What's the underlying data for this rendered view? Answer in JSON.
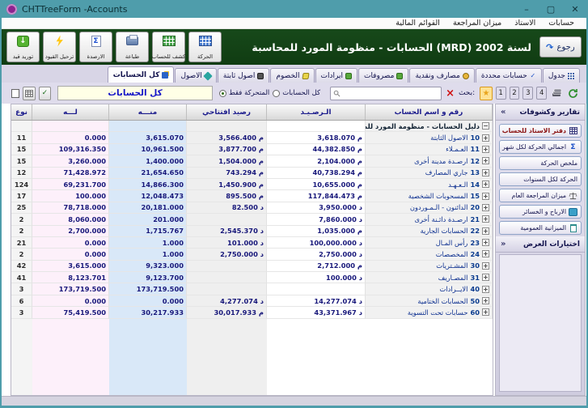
{
  "window": {
    "title": "CHTTreeForm -Accounts",
    "controls": {
      "minimize": "–",
      "maximize": "▢",
      "close": "✕"
    }
  },
  "menu": {
    "items": [
      "حسابات",
      "الاستاذ",
      "ميزان المراجعة",
      "القوائم المالية"
    ]
  },
  "header": {
    "back_label": "رجوع",
    "back_arrow": "↶",
    "title": "الحسابات - منظومة المورد للمحاسبة (MRD) لسنة 2002"
  },
  "toolbar": {
    "buttons": [
      {
        "label": "توريد قيد",
        "icon": "import-entry-icon"
      },
      {
        "label": "ترحيل القيود",
        "icon": "post-entries-icon"
      },
      {
        "label": "الارصدة",
        "icon": "balances-sigma-icon"
      },
      {
        "label": "طباعة",
        "icon": "print-icon"
      },
      {
        "label": "كشف للحساب",
        "icon": "account-statement-icon"
      },
      {
        "label": "الحركة",
        "icon": "movement-grid-icon"
      }
    ]
  },
  "tabs": [
    {
      "label": "جدول",
      "icon": "table-grid-icon"
    },
    {
      "label": "حسابات محددة",
      "icon": "check-icon"
    },
    {
      "label": "مصارف ونقدية",
      "icon": "banks-cash-icon"
    },
    {
      "label": "مصروفات",
      "icon": "expenses-icon"
    },
    {
      "label": "ايرادات",
      "icon": "revenues-icon"
    },
    {
      "label": "الخصوم",
      "icon": "liabilities-icon"
    },
    {
      "label": "اصول ثابتة",
      "icon": "fixed-assets-icon"
    },
    {
      "label": "الاصول",
      "icon": "assets-icon"
    },
    {
      "label": "كل الحسابات",
      "icon": "all-accounts-icon",
      "selected": true
    }
  ],
  "filter": {
    "scope_box": "كل الحسابات",
    "radio_moving_only": "المتحركة فقط",
    "radio_all_accounts": "كل الحسابات",
    "selected_radio": "المتحركة فقط",
    "search_label": "بحث:",
    "search_value": "",
    "page_buttons": [
      "1",
      "2",
      "3",
      "4"
    ],
    "star": "★"
  },
  "table": {
    "headers": {
      "type": "نوع",
      "credit": "لـــه",
      "debit": "منـــه",
      "opening": "رصيد افتتاحي",
      "balance": "الـرصـيـد",
      "name": "رقم و اسم الحساب"
    },
    "root_label": "دليل الحسابات - منظومة المورد للمحاسبة",
    "accounts": [
      {
        "code": "10",
        "name": "الاصول الثابتة",
        "balance": "م 3,618.070",
        "opening": "3,566.400 م",
        "debit": "3,615.070",
        "credit": "0.000",
        "type": "11"
      },
      {
        "code": "11",
        "name": "العـمـلاء",
        "balance": "م 44,382.850",
        "opening": "3,877.700 م",
        "debit": "10,961.500",
        "credit": "109,316.350",
        "type": "15"
      },
      {
        "code": "12",
        "name": "ارصـدة مدينة أخرى",
        "balance": "م 2,104.000",
        "opening": "1,504.000 م",
        "debit": "1,400.000",
        "credit": "3,260.000",
        "type": "15"
      },
      {
        "code": "13",
        "name": "جاري المصارف",
        "balance": "م 40,738.294",
        "opening": "743.294 م",
        "debit": "21,654.650",
        "credit": "71,428.972",
        "type": "12"
      },
      {
        "code": "14",
        "name": "الـعـهـد",
        "balance": "م 10,655.000",
        "opening": "1,450.900 م",
        "debit": "14,866.300",
        "credit": "69,231.700",
        "type": "124"
      },
      {
        "code": "15",
        "name": "المسحوبات الشخصية",
        "balance": "م 117,844.473",
        "opening": "895.500 م",
        "debit": "12,048.473",
        "credit": "100.000",
        "type": "17"
      },
      {
        "code": "20",
        "name": "الدائنون - الـمـوردون",
        "balance": "د 3,950.000",
        "opening": "82.500 د",
        "debit": "20,181.000",
        "credit": "78,718.000",
        "type": "25"
      },
      {
        "code": "21",
        "name": "ارصـدة دائـنة أخرى",
        "balance": "د 7,860.000",
        "opening": "",
        "debit": "201.000",
        "credit": "8,060.000",
        "type": "2"
      },
      {
        "code": "22",
        "name": "الحسابات الجارية",
        "balance": "م 1,035.000",
        "opening": "2,545.370 د",
        "debit": "1,715.767",
        "credit": "2,700.000",
        "type": "2"
      },
      {
        "code": "23",
        "name": "رأس المـال",
        "balance": "د 100,000.000",
        "opening": "101.000 د",
        "debit": "1.000",
        "credit": "0.000",
        "type": "21"
      },
      {
        "code": "24",
        "name": "المخصصات",
        "balance": "د 2,750.000",
        "opening": "2,750.000 د",
        "debit": "1.000",
        "credit": "0.000",
        "type": "2"
      },
      {
        "code": "30",
        "name": "المشـتريات",
        "balance": "م 2,712.000",
        "opening": "",
        "debit": "9,323.000",
        "credit": "3,615.000",
        "type": "42"
      },
      {
        "code": "31",
        "name": "المصـاريف",
        "balance": "د 100.000",
        "opening": "",
        "debit": "9,123.700",
        "credit": "8,123.701",
        "type": "41"
      },
      {
        "code": "40",
        "name": "الايــرادات",
        "balance": "",
        "opening": "",
        "debit": "173,719.500",
        "credit": "173,719.500",
        "type": "3"
      },
      {
        "code": "50",
        "name": "الحسابات الختامية",
        "balance": "د 14,277.074",
        "opening": "4,277.074 د",
        "debit": "0.000",
        "credit": "0.000",
        "type": "6"
      },
      {
        "code": "60",
        "name": "حسابات تحت التسوية",
        "balance": "د 43,371.967",
        "opening": "30,017.933 م",
        "debit": "30,217.933",
        "credit": "75,419.500",
        "type": "3"
      }
    ]
  },
  "sidebar": {
    "reports_header": "تقارير وكشوفات",
    "reports_chevron": "»",
    "buttons": [
      {
        "label": "دفتر الاستاذ للحساب",
        "icon": "ledger-table-icon",
        "style": "maroon"
      },
      {
        "label": "اجمالي الحركة لكل شهر",
        "icon": "sigma-icon"
      },
      {
        "label": "ملخص الحركة",
        "icon": ""
      },
      {
        "label": "الحركة لكل السنوات",
        "icon": ""
      },
      {
        "label": "ميزان المراجعة العام",
        "icon": "scale-icon"
      },
      {
        "label": "الارباح و الخسائر",
        "icon": "chart-icon"
      },
      {
        "label": "الميزانية العمومية",
        "icon": "document-icon"
      }
    ],
    "options_header": "اختيارات العرض",
    "options_chevron": "«"
  },
  "colors": {
    "titlebar": "#4f9dab",
    "green_header": "#123f12",
    "credit_col": "#fdf0fa",
    "debit_col": "#d9e8f8",
    "scope_box_bg": "#ffffe6",
    "link_text": "#1515c8",
    "maroon_button_text": "#8a1010"
  }
}
